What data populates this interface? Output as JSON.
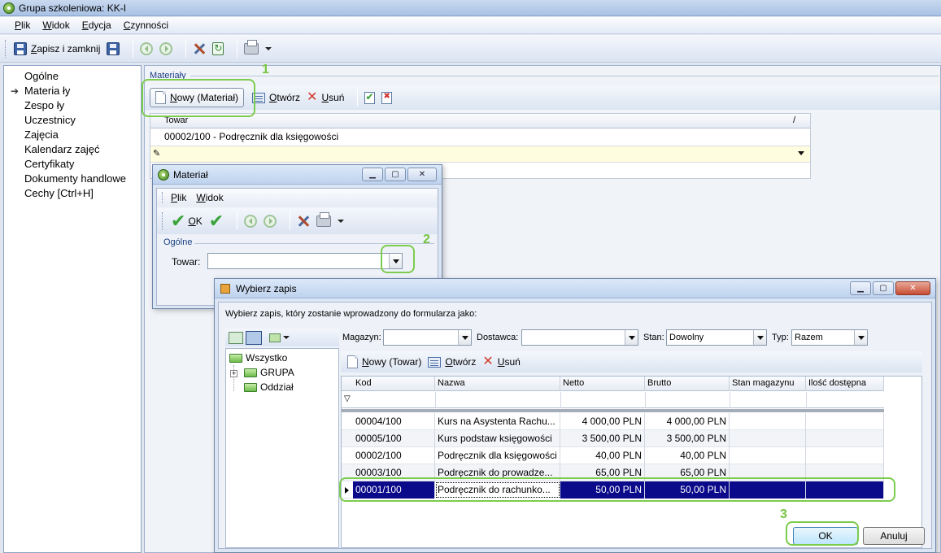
{
  "window": {
    "title": "Grupa szkoleniowa: KK-I"
  },
  "menubar": {
    "items": [
      "Plik",
      "Widok",
      "Edycja",
      "Czynności"
    ]
  },
  "toolbar": {
    "save_close_label": "Zapisz i zamknij"
  },
  "sidebar": {
    "items": [
      "Ogólne",
      "Materia ły",
      "Zespo ły",
      "Uczestnicy",
      "Zajęcia",
      "Kalendarz zajęć",
      "Certyfikaty",
      "Dokumenty handlowe",
      "Cechy [Ctrl+H]"
    ],
    "selected_index": 1
  },
  "materials": {
    "section_label": "Materiały",
    "new_label": "Nowy (Materiał)",
    "open_label": "Otwórz",
    "delete_label": "Usuń",
    "column_towar": "Towar",
    "column_slash": "/",
    "row_value": "00002/100 - Podręcznik dla księgowości"
  },
  "callouts": {
    "one": "1",
    "two": "2",
    "three": "3"
  },
  "material_dialog": {
    "title": "Materiał",
    "menu": [
      "Plik",
      "Widok"
    ],
    "ok_label": "OK",
    "section_label": "Ogólne",
    "towar_label": "Towar:",
    "towar_value": ""
  },
  "select_dialog": {
    "title": "Wybierz zapis",
    "instruction": "Wybierz zapis, który zostanie wprowadzony do formularza jako:",
    "tree": {
      "root": "Wszystko",
      "children": [
        "GRUPA",
        "Oddział"
      ]
    },
    "filters": {
      "magazyn_label": "Magazyn:",
      "magazyn_value": "",
      "dostawca_label": "Dostawca:",
      "dostawca_value": "",
      "stan_label": "Stan:",
      "stan_value": "Dowolny",
      "typ_label": "Typ:",
      "typ_value": "Razem"
    },
    "actions": {
      "new_label": "Nowy (Towar)",
      "open_label": "Otwórz",
      "delete_label": "Usuń"
    },
    "columns": [
      "Kod",
      "Nazwa",
      "Netto",
      "Brutto",
      "Stan magazynu",
      "Ilość dostępna"
    ],
    "rows": [
      {
        "kod": "00004/100",
        "nazwa": "Kurs na Asystenta Rachu...",
        "netto": "4 000,00 PLN",
        "brutto": "4 000,00 PLN"
      },
      {
        "kod": "00005/100",
        "nazwa": "Kurs podstaw księgowości",
        "netto": "3 500,00 PLN",
        "brutto": "3 500,00 PLN"
      },
      {
        "kod": "00002/100",
        "nazwa": "Podręcznik dla księgowości",
        "netto": "40,00 PLN",
        "brutto": "40,00 PLN"
      },
      {
        "kod": "00003/100",
        "nazwa": "Podręcznik do prowadze...",
        "netto": "65,00 PLN",
        "brutto": "65,00 PLN"
      },
      {
        "kod": "00001/100",
        "nazwa": "Podręcznik do rachunko...",
        "netto": "50,00 PLN",
        "brutto": "50,00 PLN"
      }
    ],
    "selected_row": 4,
    "ok_label": "OK",
    "cancel_label": "Anuluj"
  },
  "colors": {
    "selection": "#0a0a8a",
    "highlight": "#7ccc4e",
    "new_row": "#fffde0"
  }
}
